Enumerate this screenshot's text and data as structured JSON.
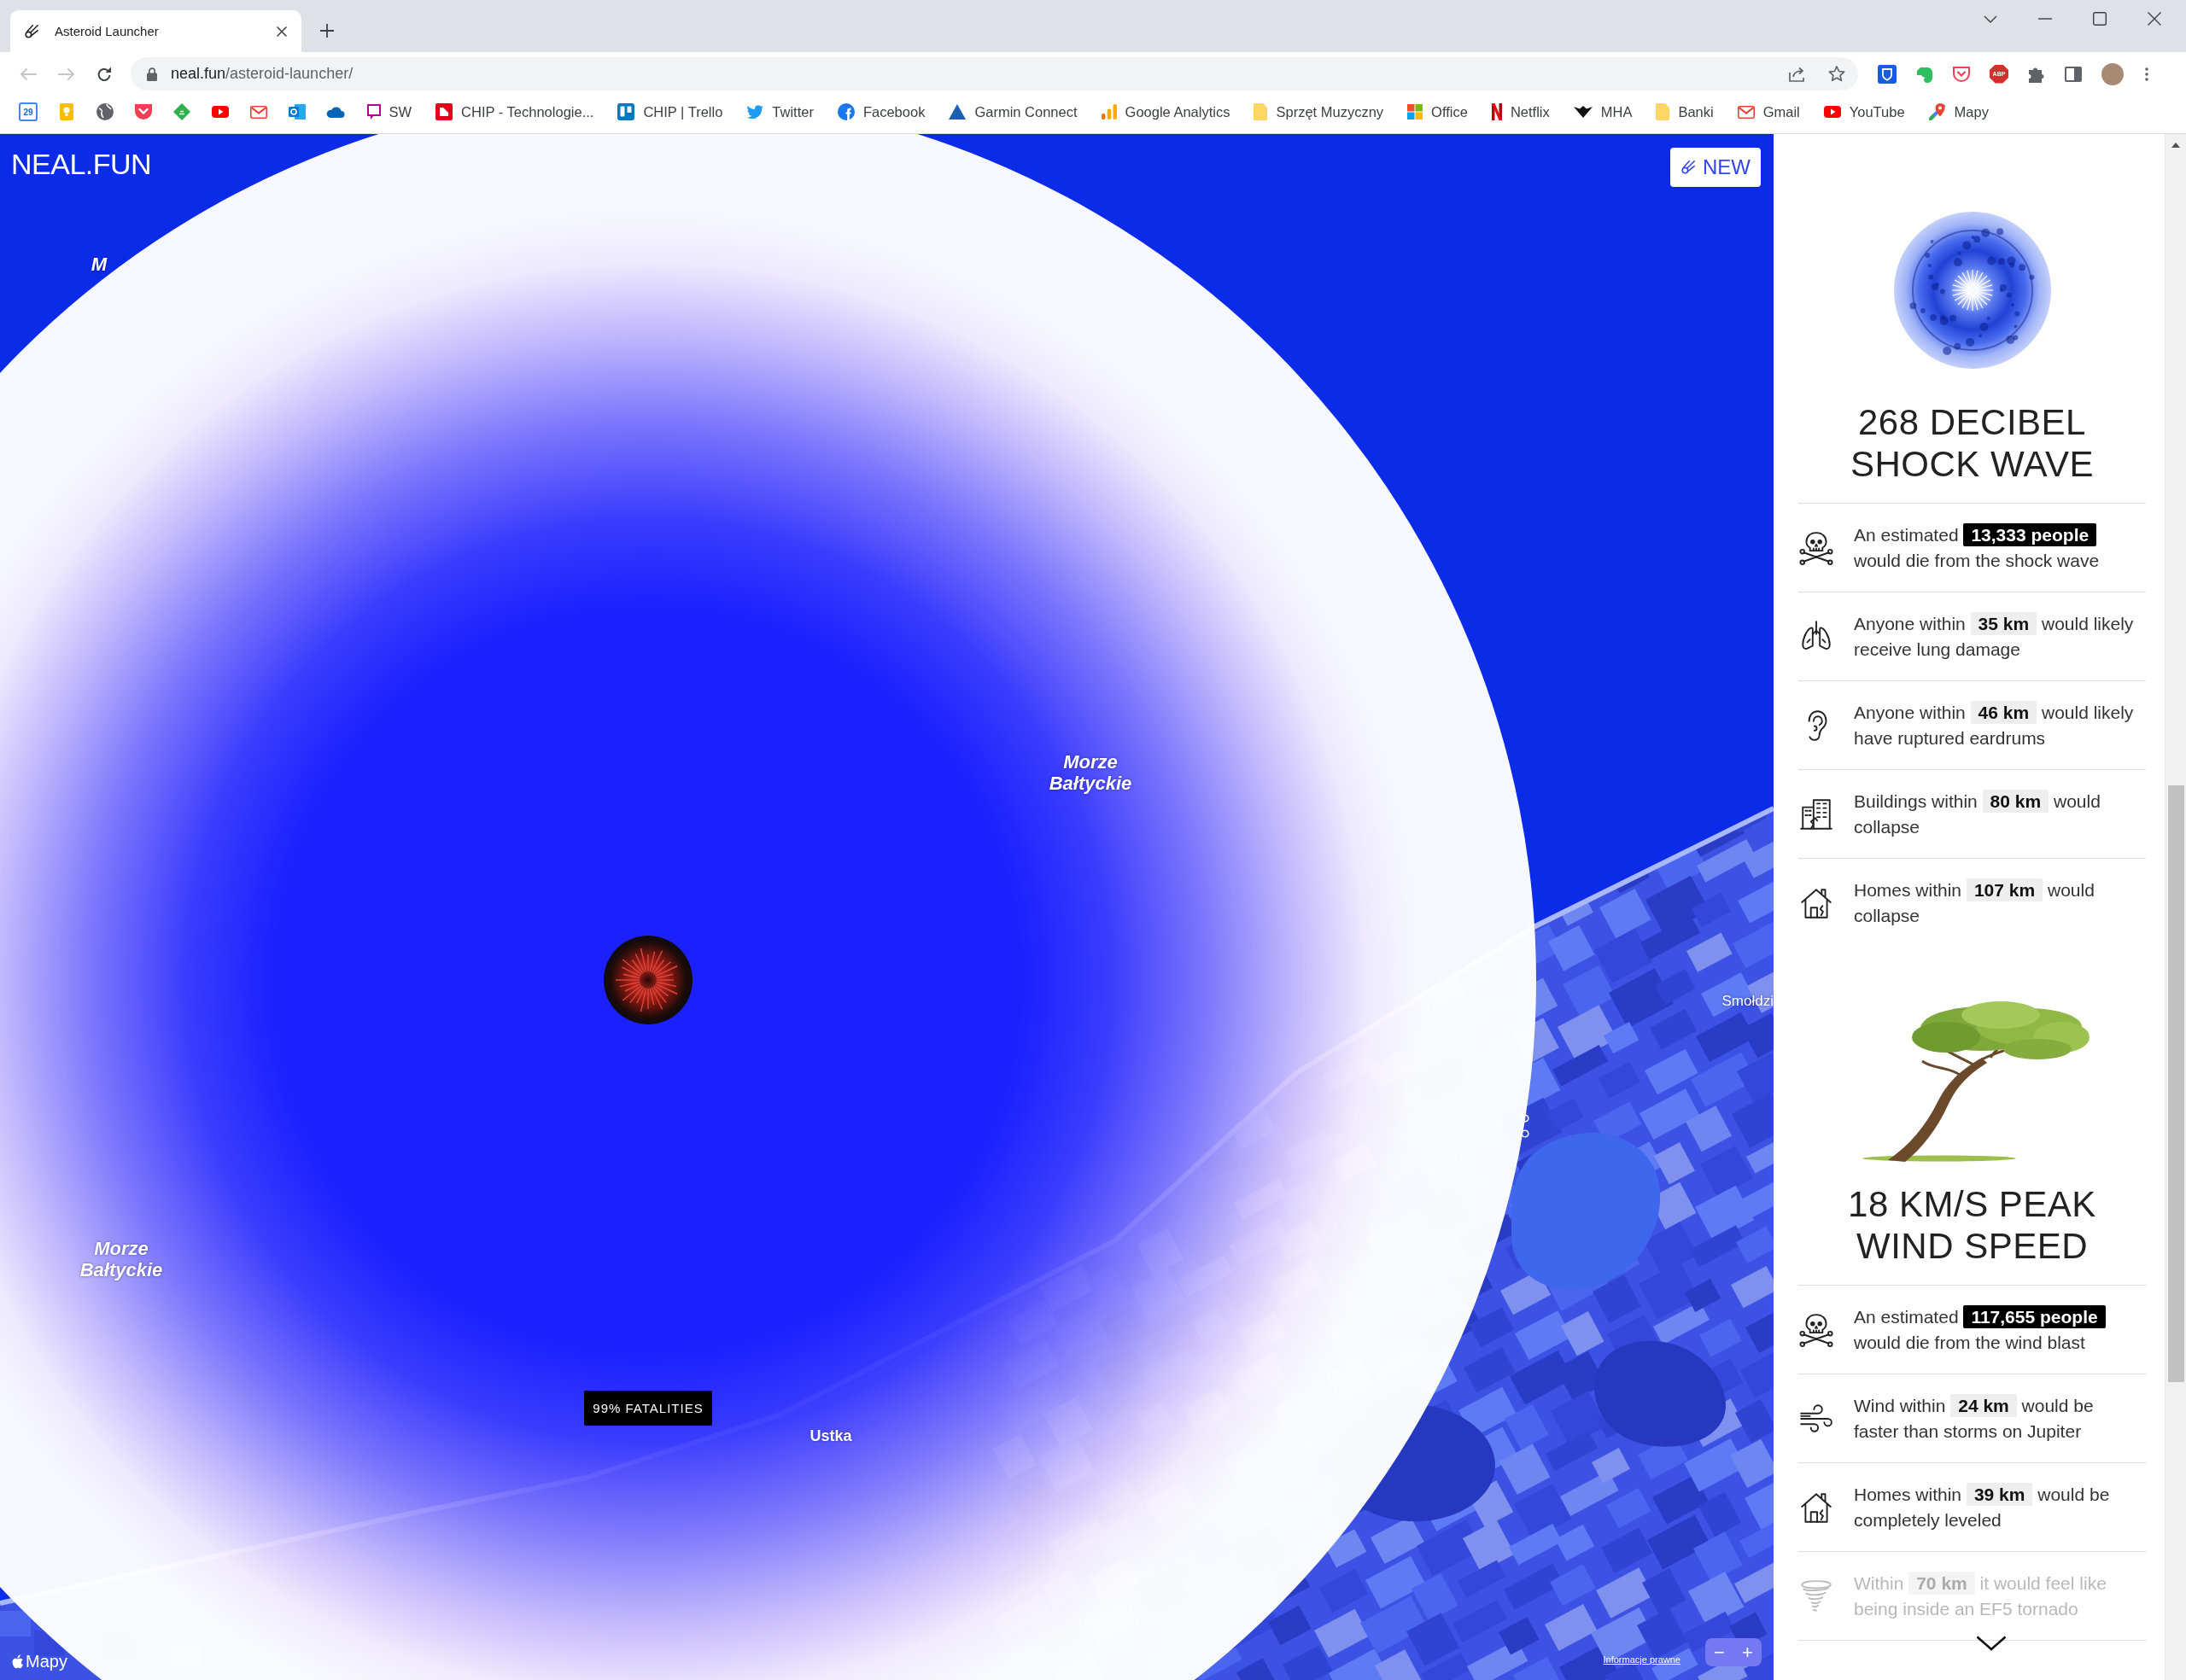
{
  "browser": {
    "tabs": [
      {
        "title": "Asteroid Launcher",
        "selected": true
      }
    ],
    "navigation": {
      "back_disabled": true,
      "forward_disabled": true
    },
    "url": {
      "host": "neal.fun",
      "path": "/asteroid-launcher/"
    },
    "extensions": [
      {
        "kind": "shield"
      },
      {
        "kind": "elephant"
      },
      {
        "kind": "pocket"
      },
      {
        "kind": "octagon",
        "label": "ABP"
      },
      {
        "kind": "puzzle"
      }
    ],
    "bookmarks": [
      {
        "kind": "calendar",
        "label": "29"
      },
      {
        "kind": "bulb"
      },
      {
        "kind": "globe"
      },
      {
        "kind": "pocket"
      },
      {
        "kind": "diamond"
      },
      {
        "kind": "play"
      },
      {
        "kind": "envelope"
      },
      {
        "kind": "mailtile"
      },
      {
        "kind": "cloud"
      },
      {
        "kind": "square",
        "label": "SW"
      },
      {
        "kind": "tile",
        "label": "CHIP - Technologie..."
      },
      {
        "kind": "board",
        "label": "CHIP | Trello"
      },
      {
        "kind": "bird",
        "label": "Twitter"
      },
      {
        "kind": "disc",
        "label": "Facebook"
      },
      {
        "kind": "triangle",
        "label": "Garmin Connect"
      },
      {
        "kind": "bars",
        "label": "Google Analytics"
      },
      {
        "kind": "folder",
        "label": "Sprzęt Muzyczny"
      },
      {
        "kind": "squares",
        "label": "Office"
      },
      {
        "kind": "ribbon",
        "label": "Netflix"
      },
      {
        "kind": "emblem",
        "label": "MHA"
      },
      {
        "kind": "folder",
        "label": "Banki"
      },
      {
        "kind": "envelope",
        "label": "Gmail"
      },
      {
        "kind": "play",
        "label": "YouTube"
      },
      {
        "kind": "pin",
        "label": "Mapy"
      }
    ]
  },
  "page": {
    "logo": "NEAL.FUN",
    "new_button": "NEW",
    "map": {
      "places": [
        {
          "kind": "sea",
          "name": "M"
        },
        {
          "kind": "sea",
          "name": "Morze Bałtyckie"
        },
        {
          "kind": "town",
          "name": "Smołdzi"
        },
        {
          "kind": "sea",
          "name": "Morze Bałtyckie"
        },
        {
          "kind": "town",
          "name": "Ustka"
        }
      ],
      "fatality_label": "99% FATALITIES",
      "attribution": "Mapy",
      "legal_link": "Informacje prawne",
      "zoom_out": "−",
      "zoom_in": "+"
    },
    "sidebar": {
      "sections": [
        {
          "kind": "shock_wave",
          "title": "268 DECIBEL SHOCK WAVE",
          "facts": [
            {
              "kind": "deaths",
              "text": "An estimated **13,333 people** would die from the shock wave",
              "dimmed": false
            },
            {
              "kind": "lungs",
              "text": "Anyone within **35 km** would likely receive lung damage",
              "dimmed": false
            },
            {
              "kind": "ears",
              "text": "Anyone within **46 km** would likely have ruptured eardrums",
              "dimmed": false
            },
            {
              "kind": "buildings",
              "text": "Buildings within **80 km** would collapse",
              "dimmed": false
            },
            {
              "kind": "homes",
              "text": "Homes within **107 km** would collapse",
              "dimmed": false
            }
          ]
        },
        {
          "kind": "wind",
          "title": "18 KM/S PEAK WIND SPEED",
          "facts": [
            {
              "kind": "deaths",
              "text": "An estimated **117,655 people** would die from the wind blast",
              "dimmed": false
            },
            {
              "kind": "wind",
              "text": "Wind within **24 km** would be faster than storms on Jupiter",
              "dimmed": false
            },
            {
              "kind": "homes",
              "text": "Homes within **39 km** would be completely leveled",
              "dimmed": false
            },
            {
              "kind": "tornado",
              "text": "Within **70 km** it would feel like being inside an EF5 tornado",
              "dimmed": true
            }
          ]
        }
      ]
    }
  }
}
